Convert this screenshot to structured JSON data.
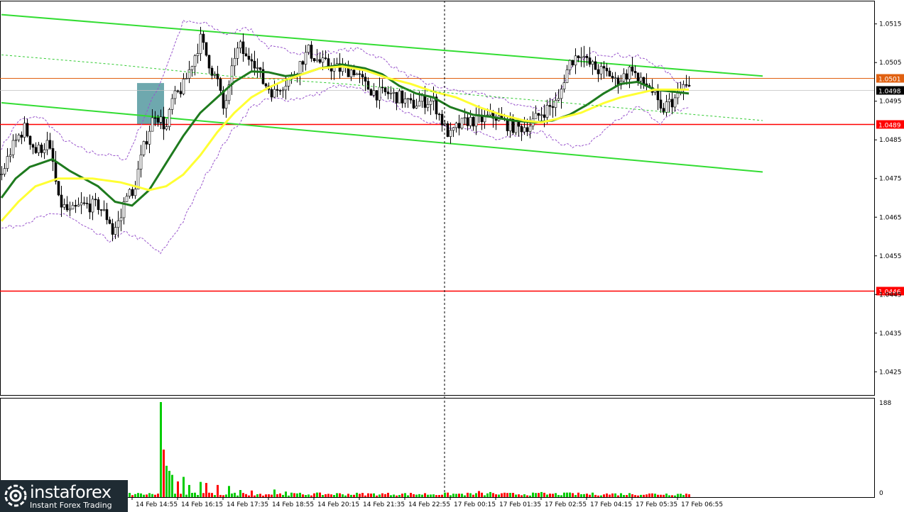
{
  "chart_data": {
    "type": "candlestick",
    "price_panel": {
      "ylim": [
        1.0419,
        1.0521
      ],
      "y_ticks": [
        "1.0515",
        "1.0505",
        "1.0495",
        "1.0485",
        "1.0475",
        "1.0465",
        "1.0455",
        "1.0445",
        "1.0435",
        "1.0425"
      ],
      "horizontal_levels": [
        {
          "label": "1.0501",
          "value": 1.0501,
          "color": "#e06010",
          "label_bg": "#e06010"
        },
        {
          "label": "1.0489",
          "value": 1.0489,
          "color": "#ff0000",
          "label_bg": "#ff0000"
        },
        {
          "label": "1.0446",
          "value": 1.0446,
          "color": "#ff0000",
          "label_bg": "#ff0000"
        }
      ],
      "current_price": {
        "label": "1.0498",
        "value": 1.04978
      },
      "trend_lines": [
        {
          "from_bar": 0,
          "from_price": 1.05174,
          "to_bar": 268,
          "to_price": 1.05015,
          "color": "#33dd33"
        },
        {
          "from_bar": 0,
          "from_price": 1.04946,
          "to_bar": 268,
          "to_price": 1.04767,
          "color": "#33dd33"
        }
      ],
      "highlight_zone": {
        "from_bar": 48,
        "to_bar": 57,
        "low": 1.0489,
        "high": 1.04997,
        "color": "#5e9ea5"
      },
      "separator_bar": 156
    },
    "moving_averages": [
      {
        "name": "",
        "color": "#1e7a1e",
        "anchors": [
          [
            0,
            1.047
          ],
          [
            5,
            1.0475
          ],
          [
            10,
            1.0478
          ],
          [
            18,
            1.048
          ],
          [
            24,
            1.0477
          ],
          [
            34,
            1.0473
          ],
          [
            40,
            1.0469
          ],
          [
            46,
            1.0468
          ],
          [
            52,
            1.0472
          ],
          [
            58,
            1.0479
          ],
          [
            64,
            1.0486
          ],
          [
            70,
            1.0492
          ],
          [
            76,
            1.0496
          ],
          [
            82,
            1.05
          ],
          [
            88,
            1.05027
          ],
          [
            94,
            1.05025
          ],
          [
            100,
            1.05015
          ],
          [
            106,
            1.0502
          ],
          [
            112,
            1.05035
          ],
          [
            120,
            1.05045
          ],
          [
            128,
            1.05035
          ],
          [
            134,
            1.0502
          ],
          [
            140,
            1.0499
          ],
          [
            146,
            1.0497
          ],
          [
            152,
            1.0496
          ],
          [
            158,
            1.04935
          ],
          [
            166,
            1.04915
          ],
          [
            172,
            1.0491
          ],
          [
            180,
            1.049
          ],
          [
            188,
            1.04895
          ],
          [
            194,
            1.049
          ],
          [
            200,
            1.04915
          ],
          [
            206,
            1.0494
          ],
          [
            212,
            1.0497
          ],
          [
            218,
            1.04995
          ],
          [
            224,
            1.05
          ],
          [
            230,
            1.0498
          ],
          [
            236,
            1.04975
          ],
          [
            242,
            1.0497
          ]
        ]
      },
      {
        "name": "",
        "color": "#ffff33",
        "anchors": [
          [
            0,
            1.0464
          ],
          [
            6,
            1.0469
          ],
          [
            12,
            1.0473
          ],
          [
            20,
            1.0475
          ],
          [
            32,
            1.0475
          ],
          [
            42,
            1.0474
          ],
          [
            52,
            1.0472
          ],
          [
            58,
            1.0473
          ],
          [
            64,
            1.0476
          ],
          [
            70,
            1.0481
          ],
          [
            76,
            1.0487
          ],
          [
            82,
            1.0492
          ],
          [
            88,
            1.0496
          ],
          [
            94,
            1.04985
          ],
          [
            100,
            1.05005
          ],
          [
            106,
            1.0502
          ],
          [
            112,
            1.05035
          ],
          [
            120,
            1.0504
          ],
          [
            128,
            1.0503
          ],
          [
            136,
            1.0501
          ],
          [
            144,
            1.04995
          ],
          [
            152,
            1.04975
          ],
          [
            160,
            1.0496
          ],
          [
            168,
            1.04935
          ],
          [
            176,
            1.04915
          ],
          [
            184,
            1.049
          ],
          [
            190,
            1.04895
          ],
          [
            196,
            1.04905
          ],
          [
            204,
            1.0492
          ],
          [
            212,
            1.04945
          ],
          [
            218,
            1.0496
          ],
          [
            224,
            1.0497
          ],
          [
            230,
            1.0498
          ],
          [
            236,
            1.0498
          ],
          [
            242,
            1.0498
          ]
        ]
      },
      {
        "name": "",
        "color": "#33cc33",
        "dashed": true,
        "anchors": [
          [
            0,
            1.0507
          ],
          [
            40,
            1.05045
          ],
          [
            80,
            1.05015
          ],
          [
            120,
            1.04995
          ],
          [
            160,
            1.0497
          ],
          [
            200,
            1.04945
          ],
          [
            240,
            1.04918
          ],
          [
            268,
            1.049
          ]
        ]
      }
    ],
    "bollinger_bands": [
      {
        "color": "#9955cc",
        "anchors": [
          [
            0,
            1.0483
          ],
          [
            6,
            1.049
          ],
          [
            14,
            1.0491
          ],
          [
            22,
            1.0485
          ],
          [
            30,
            1.0482
          ],
          [
            38,
            1.0481
          ],
          [
            44,
            1.048
          ],
          [
            50,
            1.04905
          ],
          [
            56,
            1.05
          ],
          [
            64,
            1.05155
          ],
          [
            72,
            1.0515
          ],
          [
            80,
            1.0512
          ],
          [
            86,
            1.05145
          ],
          [
            94,
            1.0509
          ],
          [
            102,
            1.0508
          ],
          [
            110,
            1.0507
          ],
          [
            118,
            1.0508
          ],
          [
            126,
            1.05085
          ],
          [
            134,
            1.0506
          ],
          [
            142,
            1.0502
          ],
          [
            150,
            1.04995
          ],
          [
            158,
            1.0498
          ],
          [
            166,
            1.0497
          ],
          [
            174,
            1.0496
          ],
          [
            182,
            1.0494
          ],
          [
            190,
            1.0493
          ],
          [
            196,
            1.0497
          ],
          [
            202,
            1.0505
          ],
          [
            208,
            1.05075
          ],
          [
            216,
            1.0507
          ],
          [
            224,
            1.05065
          ],
          [
            232,
            1.0504
          ],
          [
            238,
            1.05
          ],
          [
            242,
            1.0499
          ]
        ]
      },
      {
        "color": "#9955cc",
        "anchors": [
          [
            0,
            1.0462
          ],
          [
            6,
            1.0463
          ],
          [
            14,
            1.0465
          ],
          [
            22,
            1.0466
          ],
          [
            30,
            1.0462
          ],
          [
            38,
            1.0459
          ],
          [
            44,
            1.0461
          ],
          [
            50,
            1.0459
          ],
          [
            56,
            1.04555
          ],
          [
            64,
            1.0464
          ],
          [
            72,
            1.0476
          ],
          [
            80,
            1.0486
          ],
          [
            88,
            1.04935
          ],
          [
            94,
            1.04955
          ],
          [
            102,
            1.04955
          ],
          [
            110,
            1.04965
          ],
          [
            118,
            1.0499
          ],
          [
            126,
            1.0498
          ],
          [
            134,
            1.0496
          ],
          [
            142,
            1.04925
          ],
          [
            150,
            1.049
          ],
          [
            158,
            1.0488
          ],
          [
            166,
            1.04875
          ],
          [
            174,
            1.04855
          ],
          [
            182,
            1.04865
          ],
          [
            190,
            1.0487
          ],
          [
            196,
            1.04845
          ],
          [
            202,
            1.0483
          ],
          [
            208,
            1.04845
          ],
          [
            216,
            1.04895
          ],
          [
            224,
            1.04935
          ],
          [
            232,
            1.04895
          ],
          [
            238,
            1.04925
          ],
          [
            242,
            1.04935
          ]
        ]
      }
    ],
    "close_anchors": [
      [
        0,
        1.0476
      ],
      [
        3,
        1.0482
      ],
      [
        6,
        1.0486
      ],
      [
        8,
        1.0488
      ],
      [
        10,
        1.0485
      ],
      [
        12,
        1.0482
      ],
      [
        16,
        1.0484
      ],
      [
        18,
        1.0479
      ],
      [
        20,
        1.0469
      ],
      [
        24,
        1.0466
      ],
      [
        28,
        1.0468
      ],
      [
        34,
        1.0468
      ],
      [
        38,
        1.0464
      ],
      [
        39,
        1.0461
      ],
      [
        42,
        1.0465
      ],
      [
        44,
        1.0472
      ],
      [
        46,
        1.047
      ],
      [
        48,
        1.0477
      ],
      [
        50,
        1.0483
      ],
      [
        52,
        1.0488
      ],
      [
        54,
        1.0492
      ],
      [
        56,
        1.049
      ],
      [
        58,
        1.0488
      ],
      [
        60,
        1.0495
      ],
      [
        64,
        1.0499
      ],
      [
        68,
        1.0507
      ],
      [
        70,
        1.0511
      ],
      [
        72,
        1.0507
      ],
      [
        74,
        1.0503
      ],
      [
        76,
        1.05
      ],
      [
        78,
        1.0493
      ],
      [
        80,
        1.0498
      ],
      [
        82,
        1.0507
      ],
      [
        84,
        1.0509
      ],
      [
        86,
        1.0506
      ],
      [
        88,
        1.0507
      ],
      [
        92,
        1.05
      ],
      [
        96,
        1.0497
      ],
      [
        98,
        1.0499
      ],
      [
        102,
        1.0501
      ],
      [
        106,
        1.0506
      ],
      [
        108,
        1.0508
      ],
      [
        112,
        1.0505
      ],
      [
        116,
        1.0504
      ],
      [
        120,
        1.0503
      ],
      [
        124,
        1.0503
      ],
      [
        128,
        1.0499
      ],
      [
        132,
        1.0497
      ],
      [
        136,
        1.0497
      ],
      [
        140,
        1.0496
      ],
      [
        144,
        1.0494
      ],
      [
        148,
        1.0495
      ],
      [
        152,
        1.0495
      ],
      [
        156,
        1.0488
      ],
      [
        158,
        1.0486
      ],
      [
        160,
        1.0488
      ],
      [
        164,
        1.049
      ],
      [
        168,
        1.049
      ],
      [
        172,
        1.0491
      ],
      [
        174,
        1.0491
      ],
      [
        176,
        1.049
      ],
      [
        178,
        1.0489
      ],
      [
        182,
        1.0488
      ],
      [
        186,
        1.0489
      ],
      [
        190,
        1.0492
      ],
      [
        194,
        1.0494
      ],
      [
        196,
        1.0495
      ],
      [
        198,
        1.0501
      ],
      [
        200,
        1.0505
      ],
      [
        204,
        1.0508
      ],
      [
        206,
        1.0505
      ],
      [
        210,
        1.0503
      ],
      [
        214,
        1.0502
      ],
      [
        216,
        1.05
      ],
      [
        220,
        1.0502
      ],
      [
        222,
        1.0504
      ],
      [
        224,
        1.05
      ],
      [
        228,
        1.0499
      ],
      [
        230,
        1.0496
      ],
      [
        232,
        1.0492
      ],
      [
        234,
        1.0494
      ],
      [
        238,
        1.0496
      ],
      [
        240,
        1.0499
      ],
      [
        242,
        1.0498
      ]
    ],
    "volume_panel": {
      "ylim": [
        0,
        188
      ],
      "y_ticks": [
        "188",
        "0"
      ],
      "spikes": [
        [
          56,
          188
        ],
        [
          57,
          94
        ],
        [
          58,
          62
        ],
        [
          59,
          52
        ],
        [
          60,
          44
        ],
        [
          62,
          31
        ],
        [
          64,
          40
        ],
        [
          66,
          24
        ],
        [
          70,
          30
        ],
        [
          72,
          28
        ],
        [
          76,
          24
        ],
        [
          80,
          22
        ],
        [
          84,
          14
        ],
        [
          88,
          13
        ],
        [
          96,
          15
        ],
        [
          100,
          11
        ],
        [
          168,
          12
        ],
        [
          172,
          10
        ],
        [
          190,
          10
        ],
        [
          200,
          9
        ]
      ]
    },
    "x_ticks": [
      "14 Feb 14:55",
      "14 Feb 16:15",
      "14 Feb 17:35",
      "14 Feb 18:55",
      "14 Feb 20:15",
      "14 Feb 21:35",
      "14 Feb 22:55",
      "17 Feb 00:15",
      "17 Feb 01:35",
      "17 Feb 02:55",
      "17 Feb 04:15",
      "17 Feb 05:35",
      "17 Feb 06:55"
    ],
    "colors": {
      "bull_volume": "#00cc00",
      "bear_volume": "#ff0000",
      "candle": "#000000"
    }
  },
  "logo": {
    "name": "instaforex",
    "tagline": "Instant Forex Trading"
  }
}
